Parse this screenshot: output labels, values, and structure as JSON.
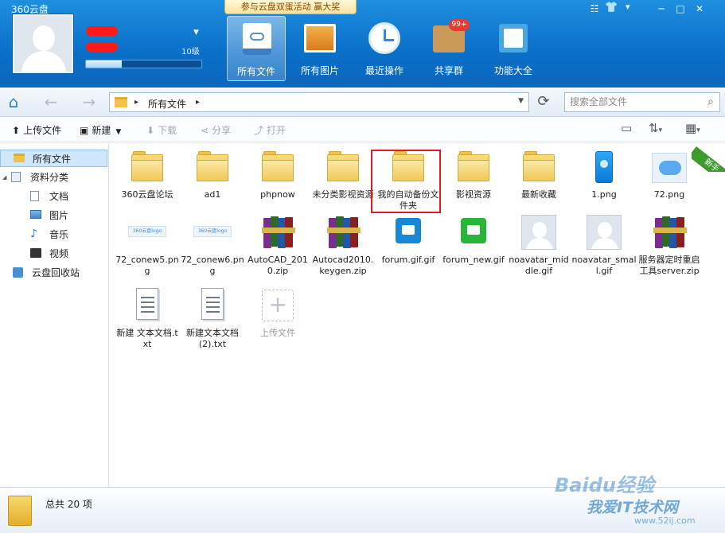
{
  "app": {
    "title": "360云盘",
    "promo": "参与云盘双蛋活动 赢大奖",
    "window_controls": [
      "☷",
      "─",
      "□",
      "✕"
    ]
  },
  "user": {
    "level": "10级",
    "level_progress": 0.31
  },
  "main_nav": [
    {
      "label": "所有文件",
      "icon": "cloud-drive-icon"
    },
    {
      "label": "所有图片",
      "icon": "pictures-icon"
    },
    {
      "label": "最近操作",
      "icon": "clock-icon"
    },
    {
      "label": "共享群",
      "icon": "share-group-icon",
      "badge": "99+"
    },
    {
      "label": "功能大全",
      "icon": "tools-icon"
    }
  ],
  "address": {
    "crumb": "所有文件",
    "search_placeholder": "搜索全部文件"
  },
  "toolbar": {
    "upload": "上传文件",
    "newfolder": "新建",
    "download": "下载",
    "share": "分享",
    "open": "打开"
  },
  "sidebar": {
    "items": [
      {
        "label": "所有文件",
        "icon": "folder-icon"
      },
      {
        "label": "资料分类",
        "icon": "category-icon"
      },
      {
        "label": "文档",
        "icon": "document-icon"
      },
      {
        "label": "图片",
        "icon": "image-icon"
      },
      {
        "label": "音乐",
        "icon": "music-icon"
      },
      {
        "label": "视频",
        "icon": "video-icon"
      },
      {
        "label": "云盘回收站",
        "icon": "recycle-bin-icon"
      }
    ]
  },
  "new_tag": "新手",
  "files": [
    {
      "name": "360云盘论坛",
      "type": "folder"
    },
    {
      "name": "ad1",
      "type": "folder"
    },
    {
      "name": "phpnow",
      "type": "folder"
    },
    {
      "name": "未分类影视资源",
      "type": "folder"
    },
    {
      "name": "我的自动备份文件夹",
      "type": "folder"
    },
    {
      "name": "影视资源",
      "type": "folder"
    },
    {
      "name": "最新收藏",
      "type": "folder"
    },
    {
      "name": "1.png",
      "type": "phone-image"
    },
    {
      "name": "72.png",
      "type": "cloud-image"
    },
    {
      "name": "72_conew5.png",
      "type": "banner-image"
    },
    {
      "name": "72_conew6.png",
      "type": "banner-image"
    },
    {
      "name": "AutoCAD_2010.zip",
      "type": "zip"
    },
    {
      "name": "Autocad2010.keygen.zip",
      "type": "zip"
    },
    {
      "name": "forum.gif.gif",
      "type": "chat-blue"
    },
    {
      "name": "forum_new.gif",
      "type": "chat-green"
    },
    {
      "name": "noavatar_middle.gif",
      "type": "avatar"
    },
    {
      "name": "noavatar_small.gif",
      "type": "avatar"
    },
    {
      "name": "服务器定时重启工具server.zip",
      "type": "zip"
    },
    {
      "name": "新建 文本文档.txt",
      "type": "txt"
    },
    {
      "name": "新建文本文档 (2).txt",
      "type": "txt"
    },
    {
      "name": "上传文件",
      "type": "upload"
    }
  ],
  "banner_text": "360云盘logo",
  "status": {
    "count": "总共 20 项"
  },
  "watermark": {
    "line1": "Baidu经验",
    "line2": "我爱IT技术网",
    "line3": "www.52ij.com"
  }
}
